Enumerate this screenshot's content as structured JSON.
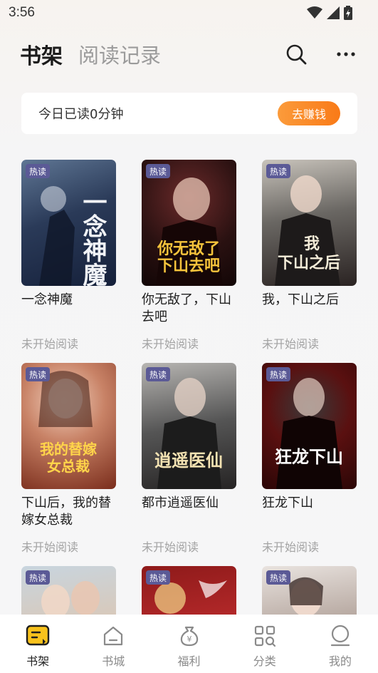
{
  "status_bar": {
    "time": "3:56"
  },
  "header": {
    "tab_bookshelf": "书架",
    "tab_history": "阅读记录"
  },
  "reading_card": {
    "text": "今日已读0分钟",
    "earn_label": "去赚钱"
  },
  "books": [
    {
      "title": "一念神魔",
      "status": "未开始阅读",
      "badge": "热读",
      "cover_text": "一念神魔"
    },
    {
      "title": "你无敌了，下山去吧",
      "status": "未开始阅读",
      "badge": "热读",
      "cover_text": "你无敌了下山去吧"
    },
    {
      "title": "我，下山之后",
      "status": "未开始阅读",
      "badge": "热读",
      "cover_text": "我下山之后"
    },
    {
      "title": "下山后，我的替嫁女总裁",
      "status": "未开始阅读",
      "badge": "热读",
      "cover_text": "我的替嫁女总裁"
    },
    {
      "title": "都市逍遥医仙",
      "status": "未开始阅读",
      "badge": "热读",
      "cover_text": "逍遥医仙"
    },
    {
      "title": "狂龙下山",
      "status": "未开始阅读",
      "badge": "热读",
      "cover_text": "狂龙下山"
    },
    {
      "title": "",
      "status": "",
      "badge": "热读",
      "cover_text": ""
    },
    {
      "title": "",
      "status": "",
      "badge": "热读",
      "cover_text": ""
    },
    {
      "title": "",
      "status": "",
      "badge": "热读",
      "cover_text": ""
    }
  ],
  "bottom_nav": [
    {
      "label": "书架",
      "icon": "bookshelf-icon",
      "active": true
    },
    {
      "label": "书城",
      "icon": "store-icon",
      "active": false
    },
    {
      "label": "福利",
      "icon": "money-bag-icon",
      "active": false
    },
    {
      "label": "分类",
      "icon": "category-icon",
      "active": false
    },
    {
      "label": "我的",
      "icon": "profile-icon",
      "active": false
    }
  ],
  "colors": {
    "accent": "#f97a17",
    "badge": "#5b5a96",
    "muted_text": "#a3a3a3"
  }
}
